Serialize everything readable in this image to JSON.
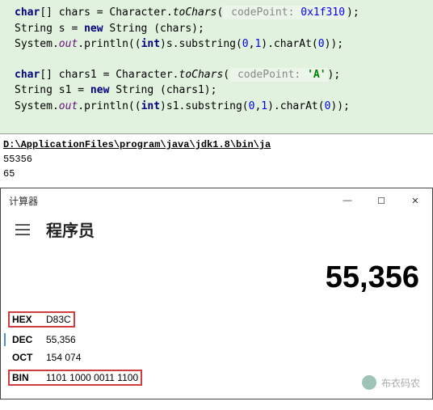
{
  "code": {
    "kw_char": "char",
    "kw_new": "new",
    "kw_int": "int",
    "chars_decl": "[] chars = Character.",
    "toChars": "toChars",
    "hint_codepoint": "codePoint:",
    "hex_val": "0x1f310",
    "paren_close_semi": ");",
    "line2_a": "String s = ",
    "line2_b": " String (chars);",
    "sys": "System.",
    "out": "out",
    "println_open": ".println((",
    "line3_b": ")s.substring(",
    "zero": "0",
    "one": "1",
    "comma": ",",
    "charAt_open": ").charAt(",
    "end": "));",
    "chars1_decl": "[] chars1 = Character.",
    "char_A": "'A'",
    "line5_a": "String s1 = ",
    "line5_b": " String (chars1);",
    "line6_b": ")s1.substring("
  },
  "console": {
    "path": "D:\\ApplicationFiles\\program\\java\\jdk1.8\\bin\\ja",
    "out1": "55356",
    "out2": "65"
  },
  "calc": {
    "title": "计算器",
    "mode": "程序员",
    "display": "55,356",
    "hex_label": "HEX",
    "hex_val": "D83C",
    "dec_label": "DEC",
    "dec_val": "55,356",
    "oct_label": "OCT",
    "oct_val": "154 074",
    "bin_label": "BIN",
    "bin_val": "1101 1000 0011 1100",
    "min": "—",
    "max": "☐",
    "close": "✕"
  },
  "watermark": "布衣码农"
}
